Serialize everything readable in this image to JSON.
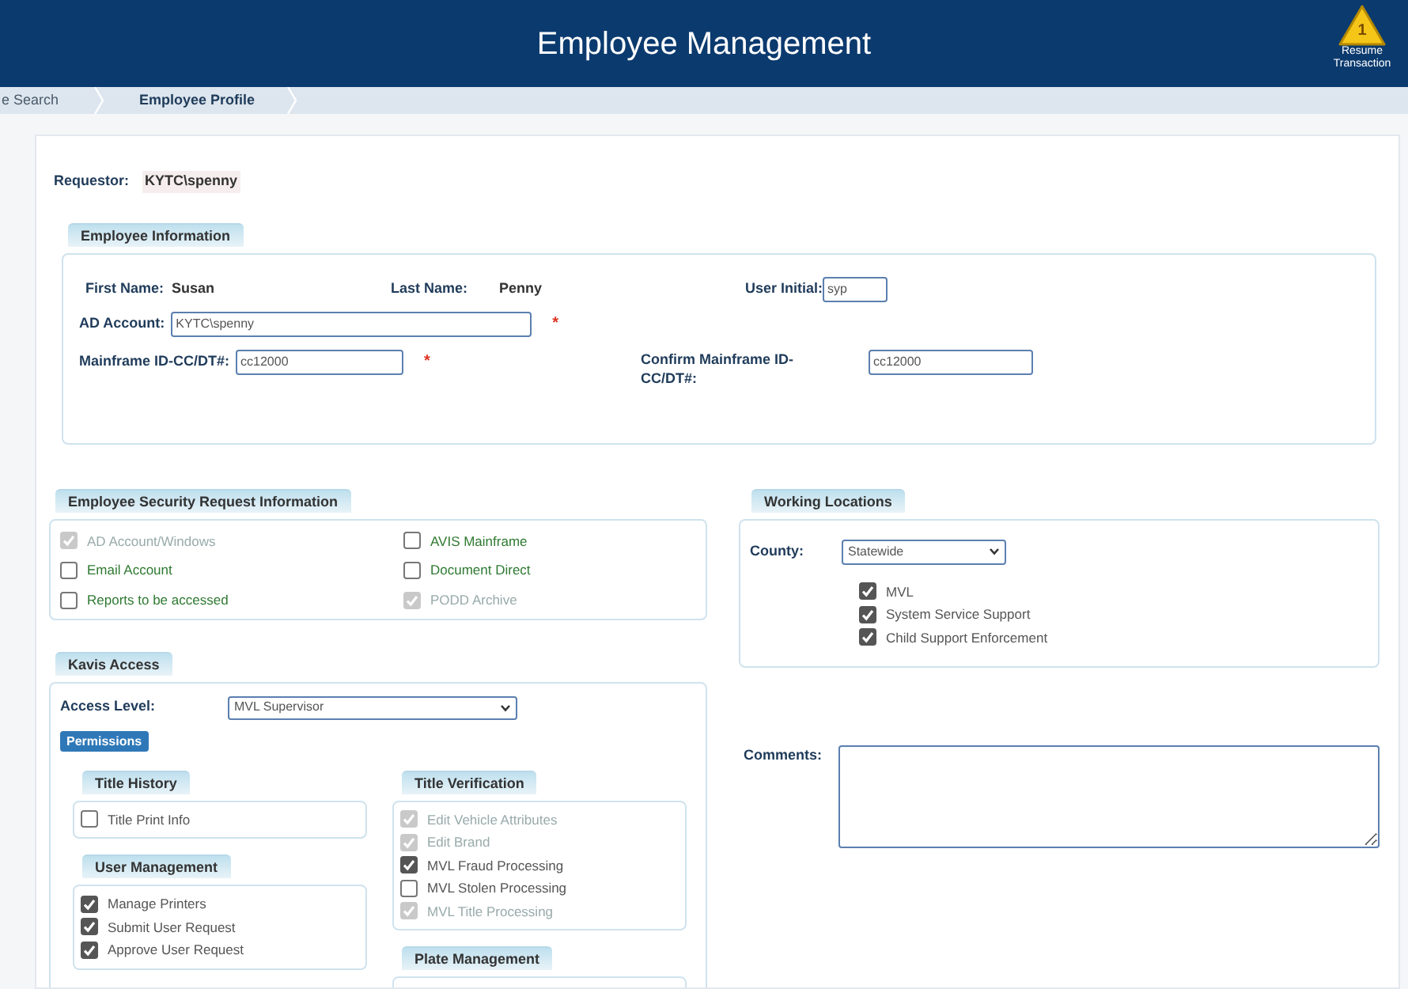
{
  "header": {
    "title": "Employee Management",
    "resume": {
      "badge": "1",
      "label": "Resume Transaction"
    }
  },
  "breadcrumbs": [
    {
      "label": "e Search",
      "selected": false
    },
    {
      "label": "Employee Profile",
      "selected": true
    }
  ],
  "requestor": {
    "label": "Requestor:",
    "value": "KYTC\\spenny"
  },
  "employee_information": {
    "legend": "Employee Information",
    "first_name": {
      "label": "First Name:",
      "value": "Susan"
    },
    "last_name": {
      "label": "Last Name:",
      "value": "Penny"
    },
    "user_initial": {
      "label": "User Initial:",
      "value": "syp"
    },
    "ad_account": {
      "label": "AD Account:",
      "value": "KYTC\\spenny",
      "required_mark": "*"
    },
    "mainframe_id": {
      "label": "Mainframe ID-CC/DT#:",
      "value": "cc12000",
      "required_mark": "*"
    },
    "confirm_mainframe_id": {
      "label": "Confirm Mainframe ID-CC/DT#:",
      "value": "cc12000"
    }
  },
  "security_request": {
    "legend": "Employee Security Request Information",
    "items": [
      {
        "label": "AD Account/Windows",
        "checked": true,
        "disabled": true
      },
      {
        "label": "Email Account",
        "checked": false,
        "disabled": false
      },
      {
        "label": "Reports to be accessed",
        "checked": false,
        "disabled": false
      },
      {
        "label": "AVIS Mainframe",
        "checked": false,
        "disabled": false
      },
      {
        "label": "Document Direct",
        "checked": false,
        "disabled": false
      },
      {
        "label": "PODD Archive",
        "checked": true,
        "disabled": true
      }
    ]
  },
  "working_locations": {
    "legend": "Working Locations",
    "county": {
      "label": "County:",
      "value": "Statewide"
    },
    "items": [
      {
        "label": "MVL",
        "checked": true,
        "disabled": false
      },
      {
        "label": "System Service Support",
        "checked": true,
        "disabled": false
      },
      {
        "label": "Child Support Enforcement",
        "checked": true,
        "disabled": false
      }
    ]
  },
  "kavis_access": {
    "legend": "Kavis Access",
    "access_level": {
      "label": "Access Level:",
      "value": "MVL Supervisor"
    },
    "permissions_button": "Permissions",
    "columns": [
      {
        "groups": [
          {
            "legend": "Title History",
            "items": [
              {
                "label": "Title Print Info",
                "checked": false,
                "disabled": false
              }
            ]
          },
          {
            "legend": "User Management",
            "items": [
              {
                "label": "Manage Printers",
                "checked": true,
                "disabled": false
              },
              {
                "label": "Submit User Request",
                "checked": true,
                "disabled": false
              },
              {
                "label": "Approve User Request",
                "checked": true,
                "disabled": false
              }
            ]
          }
        ]
      },
      {
        "groups": [
          {
            "legend": "Title Verification",
            "items": [
              {
                "label": "Edit Vehicle Attributes",
                "checked": true,
                "disabled": true
              },
              {
                "label": "Edit Brand",
                "checked": true,
                "disabled": true
              },
              {
                "label": "MVL Fraud Processing",
                "checked": true,
                "disabled": false
              },
              {
                "label": "MVL Stolen Processing",
                "checked": false,
                "disabled": false
              },
              {
                "label": "MVL Title Processing",
                "checked": true,
                "disabled": true
              }
            ]
          },
          {
            "legend": "Plate Management"
          }
        ]
      }
    ]
  },
  "comments": {
    "label": "Comments:"
  }
}
